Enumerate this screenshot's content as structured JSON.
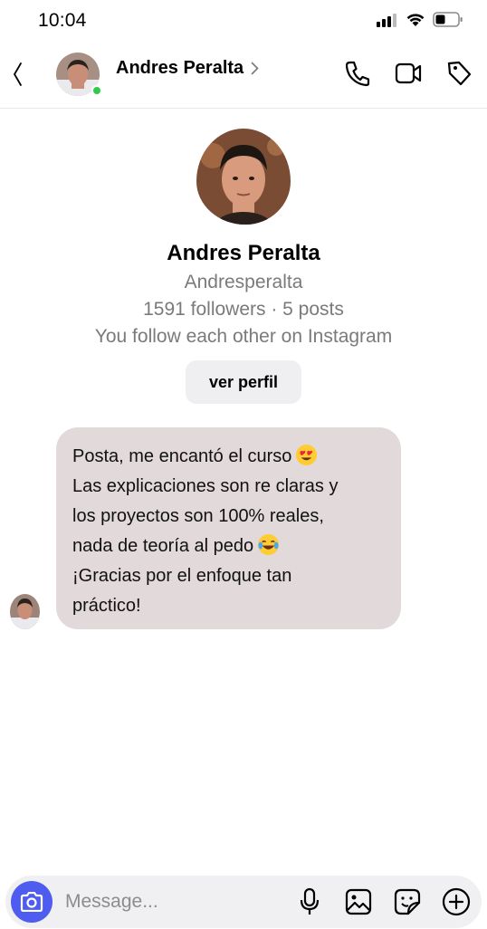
{
  "status_bar": {
    "time": "10:04",
    "icons": [
      "cellular-signal-icon",
      "wifi-icon",
      "battery-icon"
    ]
  },
  "header": {
    "back_icon": "chevron-left-icon",
    "name": "Andres Peralta",
    "online": true,
    "actions": [
      "phone-icon",
      "video-camera-icon",
      "tag-icon"
    ]
  },
  "profile": {
    "name": "Andres Peralta",
    "username": "Andresperalta",
    "stats": "1591 followers · 5 posts",
    "relation": "You follow each other on Instagram",
    "view_profile_label": "ver perfil"
  },
  "message": {
    "lines": [
      "Posta, me encantó el curso",
      "Las explicaciones son re claras y",
      "los proyectos son 100% reales,",
      "nada de teoría al pedo",
      "¡Gracias por el enfoque tan",
      "práctico!"
    ],
    "emojis": [
      "heart-eyes-emoji",
      "tears-of-joy-emoji"
    ],
    "bubble_color": "#e2d9db"
  },
  "composer": {
    "placeholder": "Message...",
    "icons": [
      "camera-icon",
      "microphone-icon",
      "image-icon",
      "sticker-icon",
      "plus-circle-icon"
    ],
    "accent": "#4e5cf0"
  },
  "colors": {
    "online": "#2ecc4a",
    "secondary_text": "#7a7a7a"
  }
}
